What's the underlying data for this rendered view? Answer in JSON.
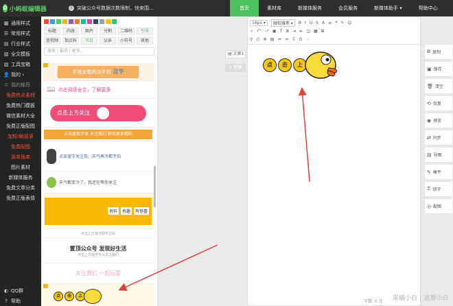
{
  "app": {
    "logo_text": "小蚂蚁编辑器"
  },
  "notice": {
    "text": "突破公众号数据次数限制，快来围..."
  },
  "nav": [
    {
      "label": "首页"
    },
    {
      "label": "素材库"
    },
    {
      "label": "新媒体服务"
    },
    {
      "label": "会员服务"
    },
    {
      "label": "新媒体助手 ▾"
    },
    {
      "label": "帮助中心"
    }
  ],
  "sidebar": {
    "items": [
      {
        "label": "通用样式",
        "icon": "▦"
      },
      {
        "label": "常用样式",
        "icon": "☰"
      },
      {
        "label": "行业样式",
        "icon": "▤"
      },
      {
        "label": "全文模板",
        "icon": "▧"
      },
      {
        "label": "工具宝箱",
        "icon": "▨"
      },
      {
        "label": "我的 ›",
        "icon": "👤"
      },
      {
        "label": "我的推荐",
        "icon": "☆"
      }
    ],
    "sub": [
      "免费热点素材",
      "免费热门模板",
      "微信素材大全",
      "免费正版配图",
      "加粉/刷阅读",
      "免费配图",
      "源单插单",
      "图片素材",
      "新媒体服务",
      "免费文章分类",
      "免费正版表情"
    ],
    "qq": "QQ群",
    "help": "帮助"
  },
  "colors": [
    "#e74c3c",
    "#3e9ae8",
    "#5cc56b",
    "#f5b50b",
    "#9b59b6",
    "#e67e22",
    "#1abc9c",
    "#e84393",
    "#34495e",
    "#95a5a6",
    "#f1c40f",
    "#2ecc71"
  ],
  "tags": {
    "row1": [
      "标题",
      "内容",
      "图片",
      "分割",
      "二维码",
      "引导"
    ],
    "row2": [
      "音视频",
      "加点料",
      "节日",
      "父亲",
      "小符号",
      "其他"
    ]
  },
  "search": {
    "placeholder": "搜索 | 最热 | 更多..."
  },
  "tiles": [
    "手指太粗的点不到",
    "蓝字",
    "点击阅读全文，了解更多",
    "点击上方关注",
    "点击蓝色字体 关注我们 获取更多精彩",
    "点击蓝字关注我，天气再冷都不怕",
    "天气都变冷了，我还在等你关注",
    "有料",
    "有趣",
    "有惊喜",
    "点击上方蓝字即可订阅",
    "置顶公众号  发现好生活",
    "点击上方蓝字可以关注我们",
    "关注我们 一起玩耍",
    "点",
    "击",
    "上"
  ],
  "doc": {
    "tab": "文章1",
    "new": "+ 新建"
  },
  "toolbar": {
    "row1": [
      "16px ▾",
      "微软雅黑 ▾",
      "B",
      "I",
      "U",
      "S",
      "A",
      "≡",
      "❝",
      "✎",
      "☺"
    ],
    "row2": [
      "✧",
      "⤺",
      "⤻",
      "▣",
      "T",
      "≣",
      "⇥",
      "⇤",
      "◫",
      "▦",
      "⊞"
    ],
    "row3": [
      "⚲",
      "◴",
      "⊗",
      "▤",
      "≔",
      "⇔",
      "↧",
      "⊡",
      "⋯"
    ]
  },
  "editor_content": {
    "chars": [
      "点",
      "击",
      "上"
    ]
  },
  "tools": [
    {
      "label": "复制",
      "icon": "⧉"
    },
    {
      "label": "保存",
      "icon": "▣"
    },
    {
      "label": "清空",
      "icon": "🗑"
    },
    {
      "label": "恢复",
      "icon": "⟲"
    },
    {
      "label": "预览",
      "icon": "◉"
    },
    {
      "label": "同步",
      "icon": "⇄"
    },
    {
      "label": "导图",
      "icon": "▤"
    },
    {
      "label": "橡平",
      "icon": "✎"
    },
    {
      "label": "锁字",
      "icon": "⚿"
    },
    {
      "label": "配图",
      "icon": "◎"
    }
  ],
  "footer": {
    "counter": "字数: 0",
    "extra": "注"
  },
  "watermark": "采编小白 | 运营小白"
}
